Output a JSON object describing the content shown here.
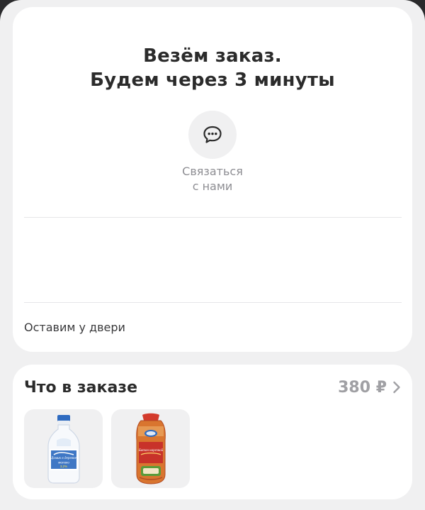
{
  "status": {
    "title_line1": "Везём заказ.",
    "title_line2": "Будем через 3 минуты",
    "contact": {
      "icon": "chat-bubble-icon",
      "label_line1": "Связаться",
      "label_line2": "с нами"
    },
    "delivery_note": "Оставим у двери"
  },
  "order": {
    "title": "Что в заказе",
    "total": "380 ₽",
    "chevron_icon": "chevron-right-icon",
    "items": [
      {
        "icon": "milk-bottle-icon",
        "label": "Домик в деревне",
        "sublabel": "молоко",
        "fat": "3,2%"
      },
      {
        "icon": "bread-bag-icon",
        "label": "Батон нарезной"
      }
    ]
  },
  "colors": {
    "background": "#f0f0f1",
    "card": "#ffffff",
    "title_text": "#2b2b2b",
    "muted_text": "#8e8e93",
    "price_text": "#a0a0a4"
  }
}
